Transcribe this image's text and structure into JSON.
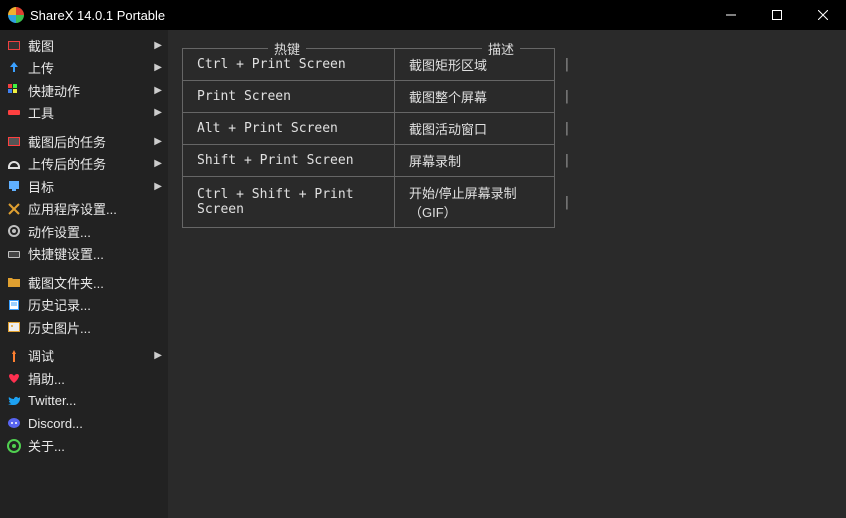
{
  "window": {
    "title": "ShareX 14.0.1 Portable"
  },
  "sidebar": [
    {
      "icon": "screenshot",
      "color": "#f04040",
      "label": "截图",
      "arrow": true
    },
    {
      "icon": "upload",
      "color": "#3aa0ff",
      "label": "上传",
      "arrow": true
    },
    {
      "icon": "quickact",
      "color": "#ff5050",
      "label": "快捷动作",
      "arrow": true
    },
    {
      "icon": "tools",
      "color": "#ff4040",
      "label": "工具",
      "arrow": true
    },
    {
      "sep": true
    },
    {
      "icon": "aftercap",
      "color": "#ff4040",
      "label": "截图后的任务",
      "arrow": true
    },
    {
      "icon": "afterup",
      "color": "#e0e0e0",
      "label": "上传后的任务",
      "arrow": true
    },
    {
      "icon": "dest",
      "color": "#60b0ff",
      "label": "目标",
      "arrow": true
    },
    {
      "icon": "appset",
      "color": "#e0a030",
      "label": "应用程序设置..."
    },
    {
      "icon": "actset",
      "color": "#c0c0c0",
      "label": "动作设置..."
    },
    {
      "icon": "hotkeyset",
      "color": "#c0c0c0",
      "label": "快捷键设置..."
    },
    {
      "sep": true
    },
    {
      "icon": "folder",
      "color": "#e0a030",
      "label": "截图文件夹..."
    },
    {
      "icon": "history",
      "color": "#3aa0ff",
      "label": "历史记录..."
    },
    {
      "icon": "imghist",
      "color": "#e0a030",
      "label": "历史图片..."
    },
    {
      "sep": true
    },
    {
      "icon": "debug",
      "color": "#ff8030",
      "label": "调试",
      "arrow": true
    },
    {
      "icon": "donate",
      "color": "#ff3050",
      "label": "捐助..."
    },
    {
      "icon": "twitter",
      "color": "#1da1f2",
      "label": "Twitter..."
    },
    {
      "icon": "discord",
      "color": "#5865f2",
      "label": "Discord..."
    },
    {
      "icon": "about",
      "color": "#50d050",
      "label": "关于..."
    }
  ],
  "table": {
    "hotkey_header": "热键",
    "desc_header": "描述",
    "rows": [
      {
        "hotkey": "Ctrl + Print Screen",
        "desc": "截图矩形区域"
      },
      {
        "hotkey": "Print Screen",
        "desc": "截图整个屏幕"
      },
      {
        "hotkey": "Alt + Print Screen",
        "desc": "截图活动窗口"
      },
      {
        "hotkey": "Shift + Print Screen",
        "desc": "屏幕录制"
      },
      {
        "hotkey": "Ctrl + Shift + Print Screen",
        "desc": "开始/停止屏幕录制（GIF）"
      }
    ]
  }
}
